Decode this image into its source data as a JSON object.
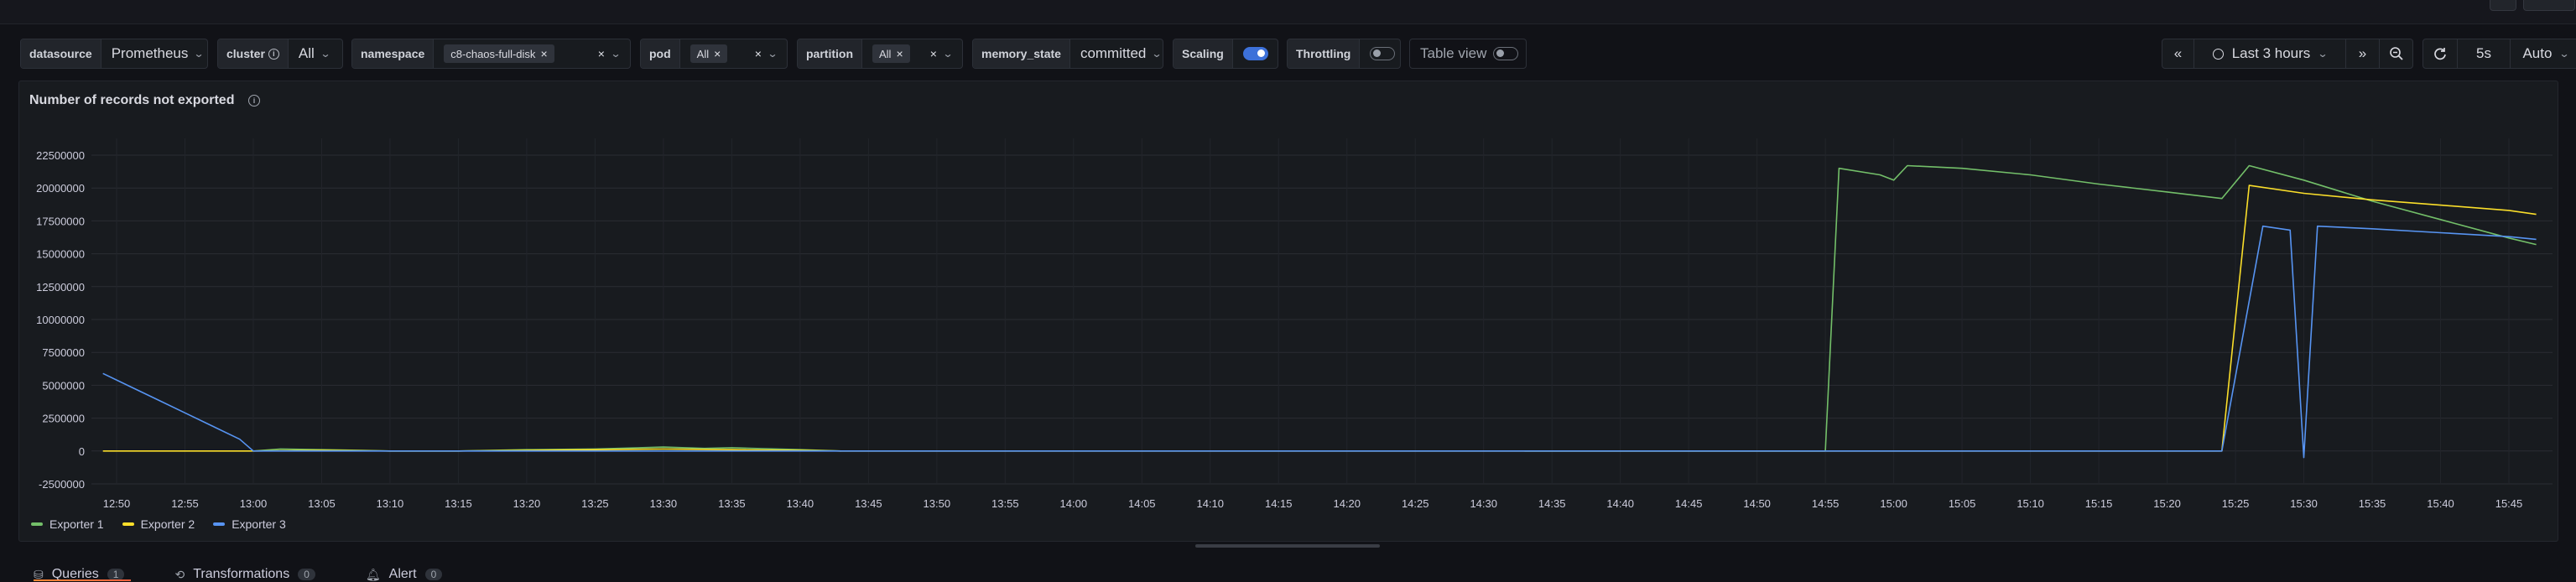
{
  "toolbar": {
    "variables": [
      {
        "label": "datasource",
        "value": "Prometheus"
      },
      {
        "label": "cluster",
        "value": "All",
        "info": "i"
      },
      {
        "label": "namespace",
        "chip": "c8-chaos-full-disk"
      },
      {
        "label": "pod",
        "chip": "All"
      },
      {
        "label": "partition",
        "chip": "All"
      },
      {
        "label": "memory_state",
        "value": "committed"
      },
      {
        "label": "Scaling",
        "toggle": true
      },
      {
        "label": "Throttling",
        "toggle": false
      }
    ],
    "table_view_label": "Table view",
    "time_range": "Last 3 hours",
    "refresh_interval": "5s",
    "refresh_mode": "Auto"
  },
  "panel": {
    "title": "Number of records not exported"
  },
  "chart_data": {
    "type": "line",
    "title": "Number of records not exported",
    "y_ticks": [
      "22500000",
      "20000000",
      "17500000",
      "15000000",
      "12500000",
      "10000000",
      "7500000",
      "5000000",
      "2500000",
      "0",
      "-2500000"
    ],
    "ylim": [
      -2500000,
      22500000
    ],
    "x_ticks": [
      "12:50",
      "12:55",
      "13:00",
      "13:05",
      "13:10",
      "13:15",
      "13:20",
      "13:25",
      "13:30",
      "13:35",
      "13:40",
      "13:45",
      "13:50",
      "13:55",
      "14:00",
      "14:05",
      "14:10",
      "14:15",
      "14:20",
      "14:25",
      "14:30",
      "14:35",
      "14:40",
      "14:45",
      "14:50",
      "14:55",
      "15:00",
      "15:05",
      "15:10",
      "15:15",
      "15:20",
      "15:25",
      "15:30",
      "15:35",
      "15:40",
      "15:45"
    ],
    "grid": true,
    "legend_position": "bottom-left",
    "series": [
      {
        "name": "Exporter 1",
        "color": "#73bf69",
        "x": [
          "12:49",
          "12:59",
          "13:00",
          "13:02",
          "13:05",
          "13:08",
          "13:10",
          "13:15",
          "13:20",
          "13:25",
          "13:30",
          "13:33",
          "13:35",
          "13:40",
          "13:43",
          "13:44",
          "14:30",
          "14:33",
          "14:54",
          "14:55",
          "14:56",
          "14:59",
          "15:00",
          "15:01",
          "15:05",
          "15:10",
          "15:15",
          "15:20",
          "15:24",
          "15:26",
          "15:30",
          "15:35",
          "15:40",
          "15:45",
          "15:47"
        ],
        "y": [
          null,
          null,
          0,
          150000,
          100000,
          50000,
          0,
          0,
          100000,
          150000,
          300000,
          200000,
          250000,
          100000,
          0,
          null,
          null,
          0,
          0,
          0,
          21500000,
          21000000,
          20600000,
          21700000,
          21500000,
          21000000,
          20300000,
          19700000,
          19200000,
          21700000,
          20600000,
          19000000,
          17600000,
          16200000,
          15700000
        ]
      },
      {
        "name": "Exporter 2",
        "color": "#fade2a",
        "x": [
          "12:49",
          "13:00",
          "13:05",
          "13:10",
          "13:15",
          "13:20",
          "13:25",
          "13:30",
          "13:35",
          "13:40",
          "13:43",
          "14:33",
          "15:24",
          "15:26",
          "15:30",
          "15:35",
          "15:40",
          "15:45",
          "15:47"
        ],
        "y": [
          0,
          0,
          50000,
          0,
          0,
          50000,
          100000,
          150000,
          100000,
          50000,
          0,
          0,
          0,
          20200000,
          19600000,
          19100000,
          18700000,
          18300000,
          18000000
        ]
      },
      {
        "name": "Exporter 3",
        "color": "#5794f2",
        "x": [
          "12:49",
          "12:51",
          "12:53",
          "12:55",
          "12:57",
          "12:59",
          "13:00",
          "13:05",
          "13:10",
          "13:15",
          "13:20",
          "13:30",
          "13:40",
          "13:45",
          "13:50",
          "14:00",
          "14:30",
          "14:55",
          "15:00",
          "15:24",
          "15:27",
          "15:29",
          "15:30",
          "15:31",
          "15:35",
          "15:40",
          "15:45",
          "15:47"
        ],
        "y": [
          5900000,
          4900000,
          3900000,
          2900000,
          1900000,
          900000,
          0,
          0,
          0,
          0,
          0,
          0,
          0,
          0,
          0,
          0,
          0,
          0,
          0,
          0,
          17100000,
          16800000,
          -500000,
          17100000,
          16900000,
          16600000,
          16300000,
          16100000
        ]
      }
    ]
  },
  "legend": [
    "Exporter 1",
    "Exporter 2",
    "Exporter 3"
  ],
  "bottom_tabs": [
    {
      "label": "Queries",
      "count": "1"
    },
    {
      "label": "Transformations",
      "count": "0"
    },
    {
      "label": "Alert",
      "count": "0"
    }
  ]
}
